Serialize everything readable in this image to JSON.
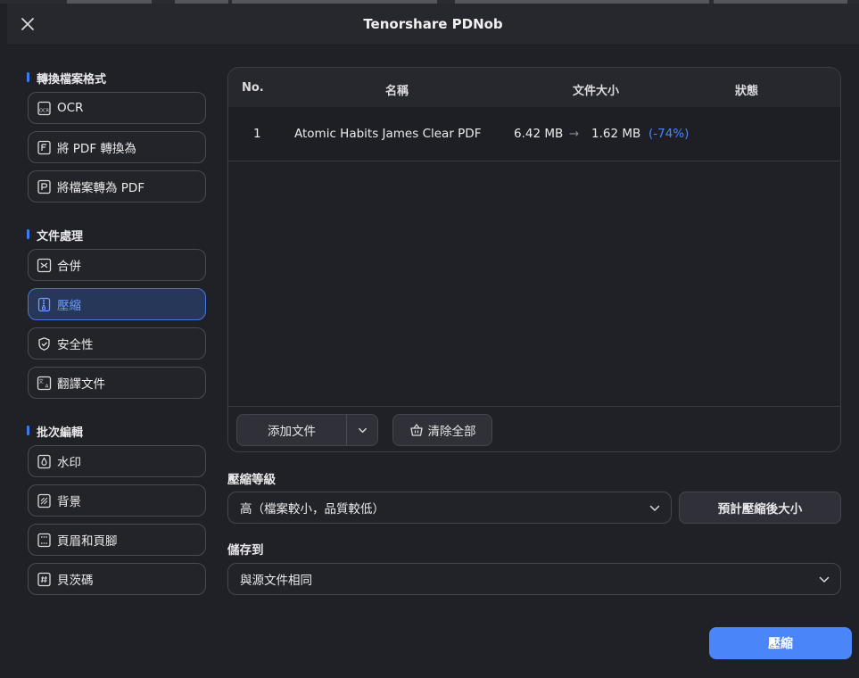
{
  "window": {
    "title": "Tenorshare PDNob"
  },
  "sidebar": {
    "sections": [
      {
        "title": "轉換檔案格式",
        "items": [
          {
            "label": "OCR",
            "icon": "ocr-icon"
          },
          {
            "label": "將 PDF 轉換為",
            "icon": "pdf-convert-icon"
          },
          {
            "label": "將檔案轉為 PDF",
            "icon": "to-pdf-icon"
          }
        ]
      },
      {
        "title": "文件處理",
        "items": [
          {
            "label": "合併",
            "icon": "merge-icon"
          },
          {
            "label": "壓縮",
            "icon": "compress-icon",
            "active": true
          },
          {
            "label": "安全性",
            "icon": "shield-icon"
          },
          {
            "label": "翻譯文件",
            "icon": "translate-icon"
          }
        ]
      },
      {
        "title": "批次編輯",
        "items": [
          {
            "label": "水印",
            "icon": "watermark-icon"
          },
          {
            "label": "背景",
            "icon": "background-icon"
          },
          {
            "label": "頁眉和頁腳",
            "icon": "header-footer-icon"
          },
          {
            "label": "貝茨碼",
            "icon": "bates-icon"
          }
        ]
      }
    ]
  },
  "table": {
    "columns": [
      "No.",
      "名稱",
      "文件大小",
      "狀態"
    ],
    "rows": [
      {
        "no": "1",
        "name": "Atomic Habits James Clear PDF",
        "size_before": "6.42 MB",
        "arrow": "→",
        "size_after": "1.62 MB",
        "change": "(-74%)"
      }
    ],
    "add_files_label": "添加文件",
    "clear_all_label": "清除全部"
  },
  "compression": {
    "label": "壓縮等級",
    "selected": "高（檔案較小，品質較低）",
    "estimate_label": "預計壓縮後大小"
  },
  "save": {
    "label": "儲存到",
    "selected": "與源文件相同"
  },
  "action": {
    "compress_label": "壓縮"
  },
  "colors": {
    "accent": "#4a86f7",
    "active_bg": "#27375a",
    "active_text": "#6d9bff",
    "background": "#202126"
  }
}
